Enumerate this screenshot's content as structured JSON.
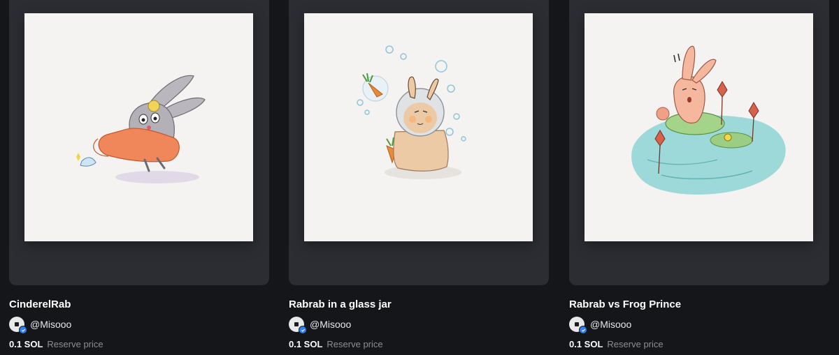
{
  "cards": [
    {
      "title": "CinderelRab",
      "creator": "@Misooo",
      "price": "0.1 SOL",
      "price_label": "Reserve price",
      "artwork": "bunny in orange dress with glass slipper"
    },
    {
      "title": "Rabrab in a glass jar",
      "creator": "@Misooo",
      "price": "0.1 SOL",
      "price_label": "Reserve price",
      "artwork": "bunny in glass jar with carrots and bubbles"
    },
    {
      "title": "Rabrab vs Frog Prince",
      "creator": "@Misooo",
      "price": "0.1 SOL",
      "price_label": "Reserve price",
      "artwork": "bunny on lily pad with frog and lotus flowers"
    }
  ],
  "colors": {
    "background": "#15161a",
    "card_frame": "#2b2d33",
    "verified_badge": "#2f80ed",
    "muted_text": "#8b8e96"
  }
}
